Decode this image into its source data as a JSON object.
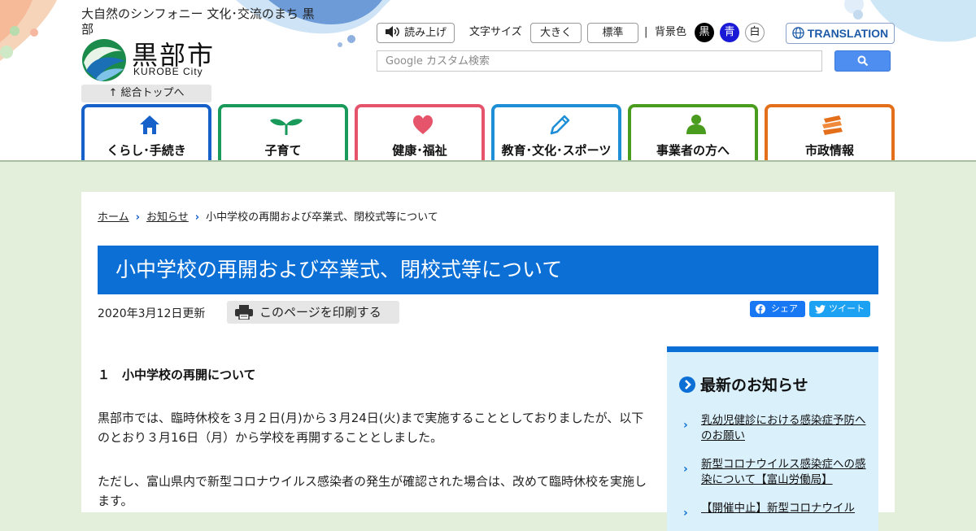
{
  "header": {
    "tagline": "大自然のシンフォニー 文化･交流のまち 黒部",
    "city_name": "黒部市",
    "city_name_en": "KUROBE City",
    "top_link": "総合トップへ",
    "read_aloud": "読み上げ",
    "font_size_label": "文字サイズ",
    "font_size_large": "大きく",
    "font_size_standard": "標準",
    "bg_color_label": "背景色",
    "bg_black": "黒",
    "bg_blue": "青",
    "bg_white": "白",
    "translation": "TRANSLATION",
    "search_placeholder": "カスタム検索",
    "search_brand": "Google"
  },
  "nav": [
    {
      "label": "くらし･手続き",
      "icon": "house-icon",
      "color": "#1661c9"
    },
    {
      "label": "子育て",
      "icon": "sprout-icon",
      "color": "#1a9a5a"
    },
    {
      "label": "健康･福祉",
      "icon": "heart-icon",
      "color": "#e5546a"
    },
    {
      "label": "教育･文化･スポーツ",
      "icon": "pencil-icon",
      "color": "#1e8fd6"
    },
    {
      "label": "事業者の方へ",
      "icon": "person-icon",
      "color": "#4a9c1e"
    },
    {
      "label": "市政情報",
      "icon": "books-icon",
      "color": "#e46f1b"
    }
  ],
  "breadcrumb": {
    "home": "ホーム",
    "news": "お知らせ",
    "current": "小中学校の再開および卒業式、閉校式等について"
  },
  "page": {
    "title": "小中学校の再開および卒業式、閉校式等について",
    "updated": "2020年3月12日更新",
    "print_label": "このページを印刷する",
    "share_label": "シェア",
    "tweet_label": "ツイート"
  },
  "article": {
    "heading": "１　小中学校の再開について",
    "paragraph1": "黒部市では、臨時休校を３月２日(月)から３月24日(火)まで実施することとしておりましたが、以下のとおり３月16日（月）から学校を再開することとしました。",
    "paragraph2": "ただし、富山県内で新型コロナウイルス感染者の発生が確認された場合は、改めて臨時休校を実施します。"
  },
  "sidebar": {
    "title": "最新のお知らせ",
    "items": [
      "乳幼児健診における感染症予防へのお願い",
      "新型コロナウイルス感染症への感染について【富山労働局】",
      "【開催中止】新型コロナウイル"
    ]
  },
  "colors": {
    "accent_blue": "#0b6fd6",
    "background_green": "#e3eedb",
    "sidebar_bg": "#daf0fb"
  }
}
